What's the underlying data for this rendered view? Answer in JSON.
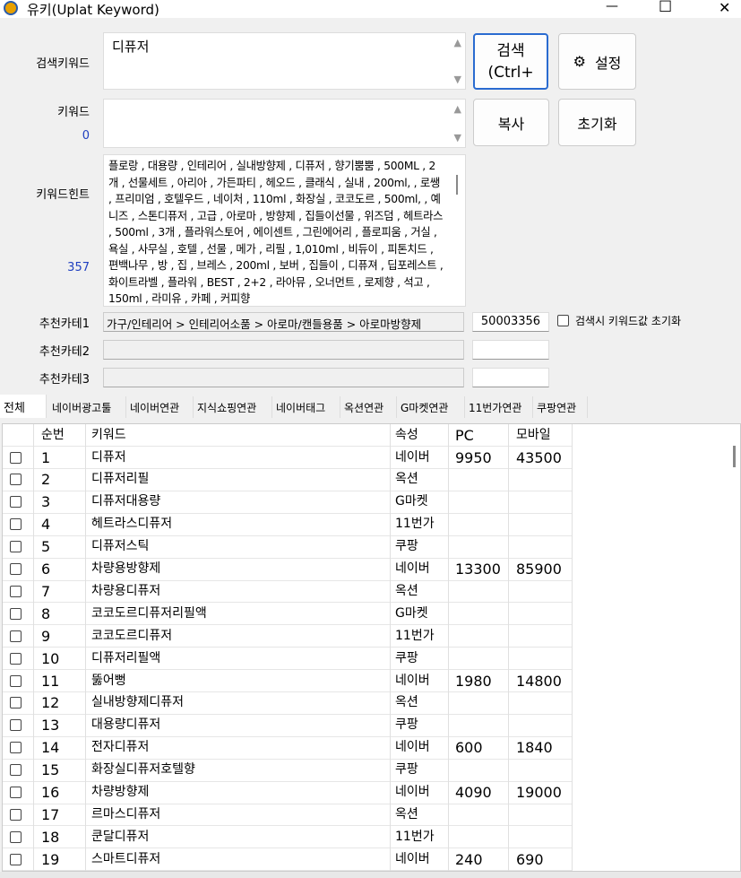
{
  "window": {
    "title": "유키(Uplat Keyword)",
    "minimize": "—",
    "maximize": "☐",
    "close": "✕"
  },
  "search": {
    "label": "검색키워드",
    "value": "디퓨저",
    "button": "검색\n(Ctrl+",
    "settings": "설정"
  },
  "keyword": {
    "label": "키워드",
    "count": "0",
    "value": "",
    "copy": "복사",
    "reset": "초기화"
  },
  "hint": {
    "label": "키워드힌트",
    "count": "357",
    "text": "플로랑 , 대용량 , 인테리어 , 실내방향제 , 디퓨저 , 향기뿜뿜 , 500ML , 2개 , 선물세트 , 아리아 , 가든파티 , 헤오드 , 클래식 , 실내 , 200ml, , 로쌩 , 프리미엄 , 호텔우드 , 네이처 , 110ml , 화장실 , 코코도르 , 500ml, , 예니즈 , 스톤디퓨저 , 고급 , 아로마 , 방향제 , 집들이선물 , 위즈덤 , 헤트라스 , 500ml , 3개 , 플라워스토어 , 에이센트 , 그린에어리 , 플로피움 , 거실 , 욕실 , 사무실 , 호텔 , 선물 , 메가 , 리필 , 1,010ml , 비듀이 , 피톤치드 , 편백나무 , 방 , 집 , 브레스 , 200ml , 보버 , 집들이 , 디퓨져 , 딥포레스트 , 화이트라벨 , 플라워 , BEST , 2+2 , 라아뮤 , 오너먼트 , 로제향 , 석고 , 150ml , 라미유 , 카페 , 커피향"
  },
  "categories": [
    {
      "label": "추천카테1",
      "path": "가구/인테리어 > 인테리어소품 > 아로마/캔들용품 > 아로마방향제",
      "code": "50003356"
    },
    {
      "label": "추천카테2",
      "path": "",
      "code": ""
    },
    {
      "label": "추천카테3",
      "path": "",
      "code": ""
    }
  ],
  "reset_checkbox": {
    "label": "검색시 키워드값 초기화",
    "checked": false
  },
  "tabs": [
    "전체",
    "네이버광고툴",
    "네이버연관",
    "지식쇼핑연관",
    "네이버태그",
    "옥션연관",
    "G마켓연관",
    "11번가연관",
    "쿠팡연관"
  ],
  "table": {
    "headers": [
      "순번",
      "키워드",
      "속성",
      "PC",
      "모바일"
    ],
    "rows": [
      [
        "1",
        "디퓨저",
        "네이버",
        "9950",
        "43500"
      ],
      [
        "2",
        "디퓨저리필",
        "옥션",
        "",
        ""
      ],
      [
        "3",
        "디퓨저대용량",
        "G마켓",
        "",
        ""
      ],
      [
        "4",
        "헤트라스디퓨저",
        "11번가",
        "",
        ""
      ],
      [
        "5",
        "디퓨저스틱",
        "쿠팡",
        "",
        ""
      ],
      [
        "6",
        "차량용방향제",
        "네이버",
        "13300",
        "85900"
      ],
      [
        "7",
        "차량용디퓨저",
        "옥션",
        "",
        ""
      ],
      [
        "8",
        "코코도르디퓨저리필액",
        "G마켓",
        "",
        ""
      ],
      [
        "9",
        "코코도르디퓨저",
        "11번가",
        "",
        ""
      ],
      [
        "10",
        "디퓨저리필액",
        "쿠팡",
        "",
        ""
      ],
      [
        "11",
        "뚫어뻥",
        "네이버",
        "1980",
        "14800"
      ],
      [
        "12",
        "실내방향제디퓨저",
        "옥션",
        "",
        ""
      ],
      [
        "13",
        "대용량디퓨저",
        "쿠팡",
        "",
        ""
      ],
      [
        "14",
        "전자디퓨저",
        "네이버",
        "600",
        "1840"
      ],
      [
        "15",
        "화장실디퓨저호텔향",
        "쿠팡",
        "",
        ""
      ],
      [
        "16",
        "차량방향제",
        "네이버",
        "4090",
        "19000"
      ],
      [
        "17",
        "르마스디퓨저",
        "옥션",
        "",
        ""
      ],
      [
        "18",
        "쿤달디퓨저",
        "11번가",
        "",
        ""
      ],
      [
        "19",
        "스마트디퓨저",
        "네이버",
        "240",
        "690"
      ]
    ]
  }
}
